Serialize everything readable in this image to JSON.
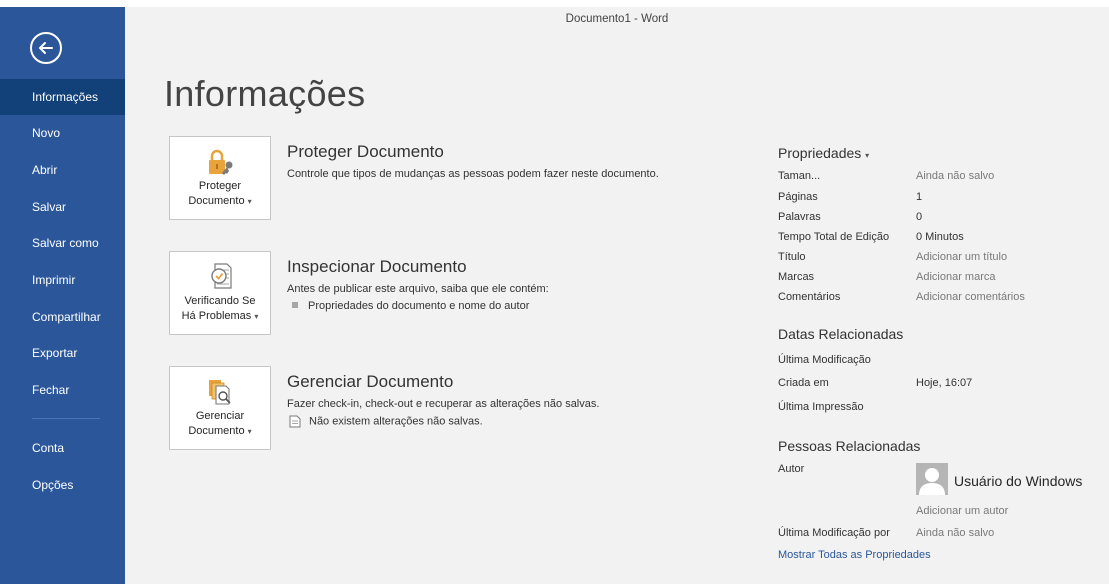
{
  "window": {
    "title": "Documento1 - Word"
  },
  "sidebar": {
    "items": [
      {
        "label": "Informações",
        "active": true
      },
      {
        "label": "Novo"
      },
      {
        "label": "Abrir"
      },
      {
        "label": "Salvar"
      },
      {
        "label": "Salvar como"
      },
      {
        "label": "Imprimir"
      },
      {
        "label": "Compartilhar"
      },
      {
        "label": "Exportar"
      },
      {
        "label": "Fechar"
      },
      {
        "label": "Conta"
      },
      {
        "label": "Opções"
      }
    ]
  },
  "main": {
    "title": "Informações",
    "sections": [
      {
        "button_line1": "Proteger",
        "button_line2": "Documento",
        "heading": "Proteger Documento",
        "description": "Controle que tipos de mudanças as pessoas podem fazer neste documento.",
        "icon": "lock-key-icon"
      },
      {
        "button_line1": "Verificando Se",
        "button_line2": "Há Problemas",
        "heading": "Inspecionar Documento",
        "description": "Antes de publicar este arquivo, saiba que ele contém:",
        "bullet": "Propriedades do documento e nome do autor",
        "icon": "inspect-document-icon"
      },
      {
        "button_line1": "Gerenciar",
        "button_line2": "Documento",
        "heading": "Gerenciar Documento",
        "description": "Fazer check-in, check-out e recuperar as alterações não salvas.",
        "bullet": "Não existem alterações não salvas.",
        "icon": "manage-document-icon"
      }
    ]
  },
  "properties": {
    "heading": "Propriedades",
    "rows": [
      {
        "label": "Taman...",
        "value": "Ainda não salvo"
      },
      {
        "label": "Páginas",
        "value": "1"
      },
      {
        "label": "Palavras",
        "value": "0"
      },
      {
        "label": "Tempo Total de Edição",
        "value": "0 Minutos"
      },
      {
        "label": "Título",
        "value": "Adicionar um título"
      },
      {
        "label": "Marcas",
        "value": "Adicionar marca"
      },
      {
        "label": "Comentários",
        "value": "Adicionar comentários"
      }
    ]
  },
  "related_dates": {
    "heading": "Datas Relacionadas",
    "rows": [
      {
        "label": "Última Modificação",
        "value": ""
      },
      {
        "label": "Criada em",
        "value": "Hoje, 16:07"
      },
      {
        "label": "Última Impressão",
        "value": ""
      }
    ]
  },
  "related_people": {
    "heading": "Pessoas Relacionadas",
    "author_label": "Autor",
    "author_name": "Usuário do Windows",
    "add_author": "Adicionar um autor",
    "last_modified_by_label": "Última Modificação por",
    "last_modified_by_value": "Ainda não salvo"
  },
  "show_all_link": "Mostrar Todas as Propriedades",
  "colors": {
    "sidebar": "#2b579a",
    "sidebar_active": "#124078",
    "link": "#2b579a",
    "background": "#f2f2f2"
  }
}
